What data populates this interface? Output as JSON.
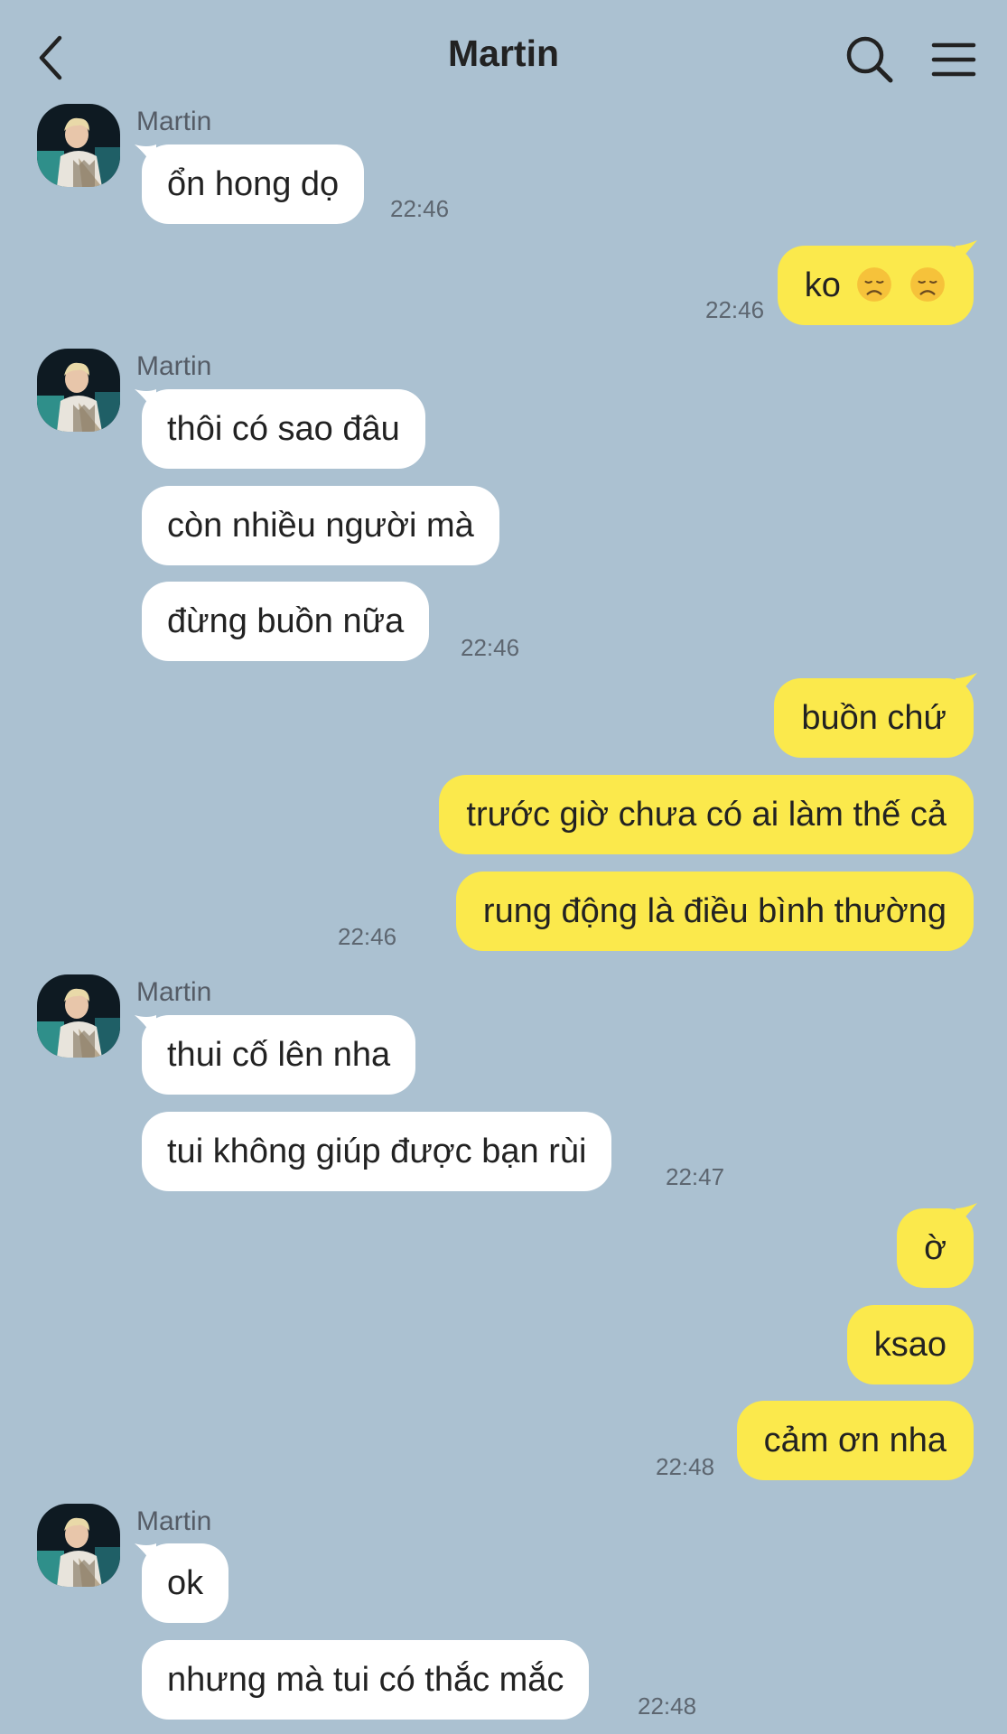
{
  "header": {
    "title": "Martin",
    "back_icon": "chevron-left-icon",
    "search_icon": "search-icon",
    "menu_icon": "hamburger-menu-icon"
  },
  "colors": {
    "background": "#abc1d1",
    "incoming_bubble": "#ffffff",
    "outgoing_bubble": "#fbe94c"
  },
  "messages": {
    "g1": {
      "sender": "Martin",
      "m1": "ổn hong dọ",
      "time": "22:46"
    },
    "g2": {
      "m1": "ko",
      "emoji": "disappointed-face",
      "time": "22:46"
    },
    "g3": {
      "sender": "Martin",
      "m1": "thôi có sao đâu",
      "m2": "còn nhiều người mà",
      "m3": "đừng buồn nữa",
      "time": "22:46"
    },
    "g4": {
      "m1": "buồn chứ",
      "m2": "trước giờ chưa có ai làm thế cả",
      "m3": "rung động là điều bình thường",
      "time": "22:46"
    },
    "g5": {
      "sender": "Martin",
      "m1": "thui cố lên nha",
      "m2": "tui không giúp được bạn rùi",
      "time": "22:47"
    },
    "g6": {
      "m1": "ờ",
      "m2": "ksao",
      "m3": "cảm ơn nha",
      "time": "22:48"
    },
    "g7": {
      "sender": "Martin",
      "m1": "ok",
      "m2": "nhưng mà tui có thắc mắc",
      "time": "22:48"
    }
  }
}
